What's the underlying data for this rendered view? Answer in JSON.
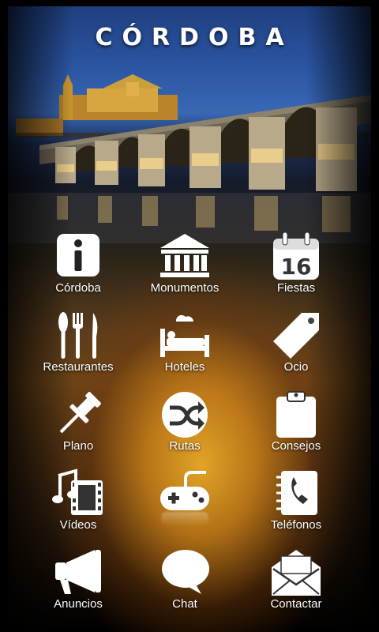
{
  "app": {
    "title": "CÓRDOBA"
  },
  "menu": {
    "items": [
      {
        "label": "Córdoba",
        "icon": "info-icon"
      },
      {
        "label": "Monumentos",
        "icon": "temple-icon"
      },
      {
        "label": "Fiestas",
        "icon": "calendar-icon",
        "calendar_day": "16"
      },
      {
        "label": "Restaurantes",
        "icon": "cutlery-icon"
      },
      {
        "label": "Hoteles",
        "icon": "hotel-bed-icon"
      },
      {
        "label": "Ocio",
        "icon": "tag-icon"
      },
      {
        "label": "Plano",
        "icon": "pushpin-icon"
      },
      {
        "label": "Rutas",
        "icon": "shuffle-icon"
      },
      {
        "label": "Consejos",
        "icon": "clipboard-icon"
      },
      {
        "label": "Vídeos",
        "icon": "music-film-icon"
      },
      {
        "label": "",
        "icon": "gamepad-icon"
      },
      {
        "label": "Teléfonos",
        "icon": "phone-book-icon"
      },
      {
        "label": "Anuncios",
        "icon": "megaphone-icon"
      },
      {
        "label": "Chat",
        "icon": "speech-bubble-icon"
      },
      {
        "label": "Contactar",
        "icon": "envelope-icon"
      }
    ]
  },
  "colors": {
    "icon": "#ffffff",
    "text": "#ffffff",
    "glow": "#e6a22a"
  }
}
